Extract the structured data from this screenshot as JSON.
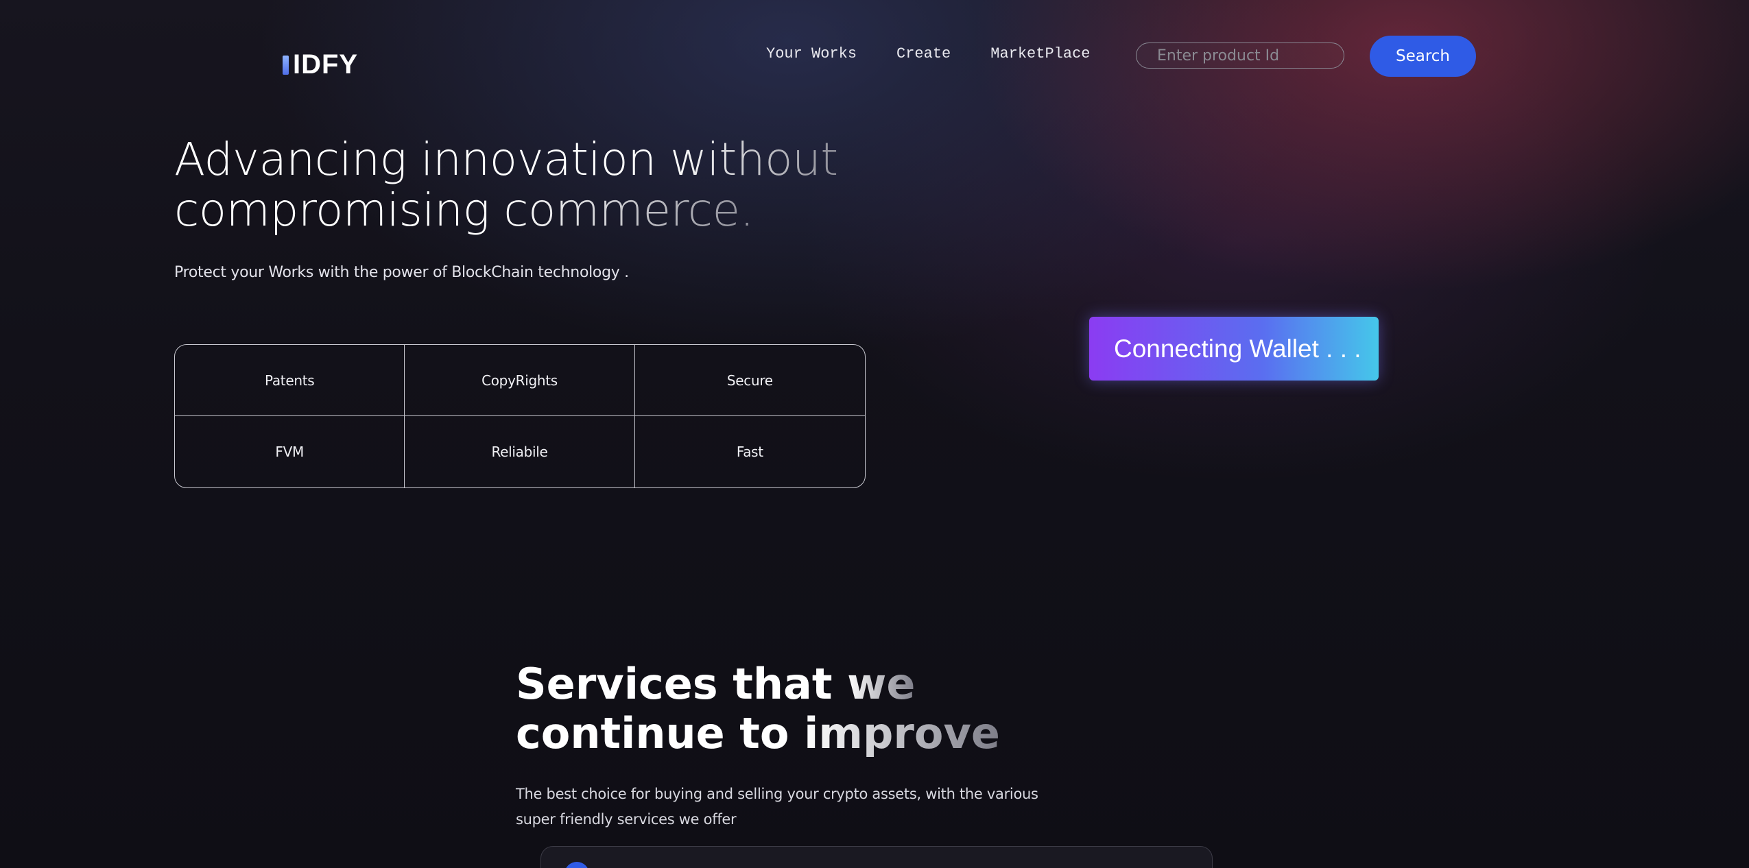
{
  "header": {
    "logo_text": "IDFY",
    "nav": [
      {
        "label": "Your Works"
      },
      {
        "label": "Create"
      },
      {
        "label": "MarketPlace"
      }
    ],
    "search": {
      "placeholder": "Enter product Id",
      "value": "",
      "button_label": "Search"
    }
  },
  "hero": {
    "title_line1_main": "Advancing innovation ",
    "title_line1_fade": "without",
    "title_line2_main": "compromising ",
    "title_line2_fade": "commerce.",
    "subtitle": "Protect your Works with the power of BlockChain technology .",
    "features": [
      "Patents",
      "CopyRights",
      "Secure",
      "FVM",
      "Reliabile",
      "Fast"
    ],
    "wallet_button": "Connecting Wallet . . ."
  },
  "services": {
    "title_line1_main": "Services that ",
    "title_line1_fade": "we",
    "title_line2_main": "continue to ",
    "title_line2_fade": "improve",
    "description": "The best choice for buying and selling your crypto assets, with the various super friendly services we offer"
  },
  "colors": {
    "background": "#0f0e15",
    "accent_blue": "#2f5be6",
    "wallet_gradient_start": "#8b3cf2",
    "wallet_gradient_end": "#45c7ea",
    "glow_red": "#a0344e"
  },
  "icons": {
    "logo_mark": "logo-bar-icon",
    "service_card": "service-circle-icon"
  }
}
